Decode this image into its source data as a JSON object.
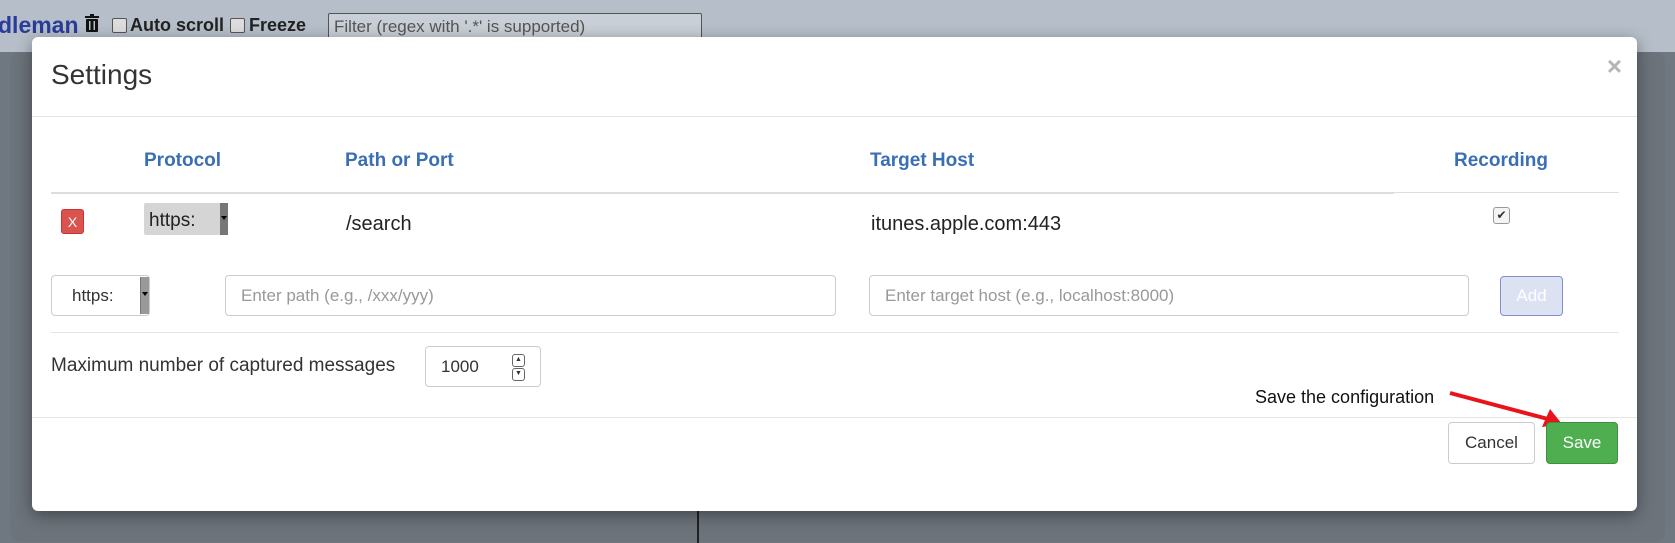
{
  "app": {
    "brand": "dleman",
    "auto_scroll_label": "Auto scroll",
    "freeze_label": "Freeze",
    "filter_placeholder": "Filter (regex with '.*' is supported)"
  },
  "modal": {
    "title": "Settings",
    "close_glyph": "×",
    "columns": [
      "Protocol",
      "Path or Port",
      "Target Host",
      "Recording"
    ],
    "rows": [
      {
        "delete_label": "X",
        "protocol": "https:",
        "path": "/search",
        "target_host": "itunes.apple.com:443",
        "recording": true
      }
    ],
    "new_rule": {
      "protocol": "https:",
      "path_placeholder": "Enter path (e.g., /xxx/yyy)",
      "host_placeholder": "Enter target host (e.g., localhost:8000)",
      "add_label": "Add"
    },
    "max_messages": {
      "label": "Maximum number of captured messages",
      "value": "1000"
    },
    "annotation": "Save the configuration",
    "cancel_label": "Cancel",
    "save_label": "Save"
  },
  "colors": {
    "accent": "#3a6fb5",
    "danger": "#d9534f",
    "success": "#4fae4f",
    "annotation_arrow": "#e8131b"
  },
  "icons": [
    "trash-icon",
    "close-icon",
    "checkbox-checked-icon",
    "dropdown-arrow-icon",
    "spinner-up-icon",
    "spinner-down-icon",
    "arrow-annotation-icon"
  ]
}
